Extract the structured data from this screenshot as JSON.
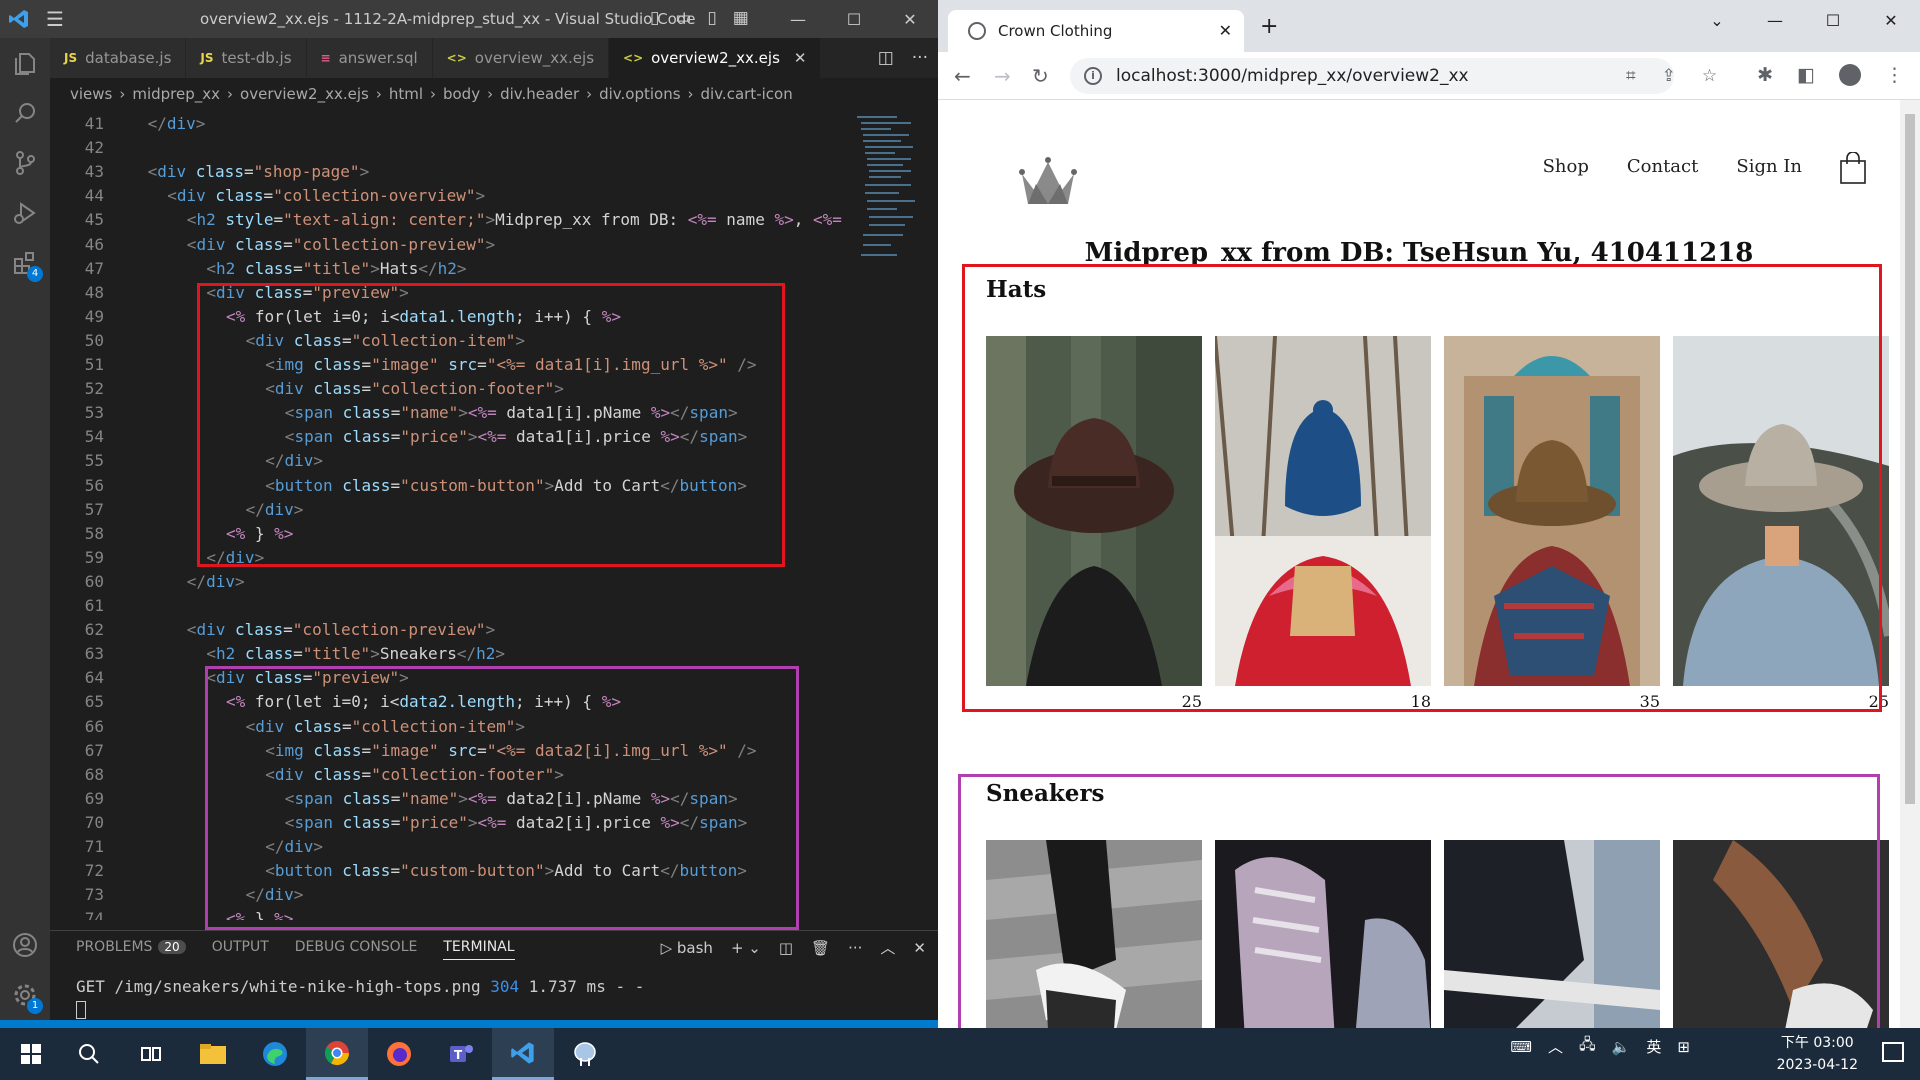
{
  "vscode": {
    "window_title": "overview2_xx.ejs - 1112-2A-midprep_stud_xx - Visual Studio Code",
    "tabs": [
      {
        "label": "database.js",
        "icon": "JS",
        "icon_color": "#e8d44d"
      },
      {
        "label": "test-db.js",
        "icon": "JS",
        "icon_color": "#e8d44d"
      },
      {
        "label": "answer.sql",
        "icon": "≡",
        "icon_color": "#e05d8a"
      },
      {
        "label": "overview_xx.ejs",
        "icon": "<>",
        "icon_color": "#cbcb41"
      },
      {
        "label": "overview2_xx.ejs",
        "icon": "<>",
        "icon_color": "#cbcb41",
        "active": true
      }
    ],
    "breadcrumb": [
      "views",
      "midprep_xx",
      "overview2_xx.ejs",
      "html",
      "body",
      "div.header",
      "div.options",
      "div.cart-icon"
    ],
    "extensions_badge": "4",
    "settings_badge": "1",
    "code_lines": [
      {
        "n": "41",
        "html": "<span class='br'>&lt;/</span><span class='tg'>div</span><span class='br'>&gt;</span>",
        "indent": 1
      },
      {
        "n": "42",
        "html": "",
        "indent": 0
      },
      {
        "n": "43",
        "html": "<span class='br'>&lt;</span><span class='tg'>div</span> <span class='at'>class</span><span class='tx'>=</span><span class='st'>\"shop-page\"</span><span class='br'>&gt;</span>",
        "indent": 1
      },
      {
        "n": "44",
        "html": "<span class='br'>&lt;</span><span class='tg'>div</span> <span class='at'>class</span><span class='tx'>=</span><span class='st'>\"collection-overview\"</span><span class='br'>&gt;</span>",
        "indent": 2
      },
      {
        "n": "45",
        "html": "<span class='br'>&lt;</span><span class='tg'>h2</span> <span class='at'>style</span><span class='tx'>=</span><span class='st'>\"text-align: center;\"</span><span class='br'>&gt;</span><span class='tx'>Midprep_xx from DB: </span><span class='kw'>&lt;%=</span><span class='tx'> name </span><span class='kw'>%&gt;</span><span class='tx'>, </span><span class='kw'>&lt;%=</span>",
        "indent": 3
      },
      {
        "n": "46",
        "html": "<span class='br'>&lt;</span><span class='tg'>div</span> <span class='at'>class</span><span class='tx'>=</span><span class='st'>\"collection-preview\"</span><span class='br'>&gt;</span>",
        "indent": 3
      },
      {
        "n": "47",
        "html": "<span class='br'>&lt;</span><span class='tg'>h2</span> <span class='at'>class</span><span class='tx'>=</span><span class='st'>\"title\"</span><span class='br'>&gt;</span><span class='tx'>Hats</span><span class='br'>&lt;/</span><span class='tg'>h2</span><span class='br'>&gt;</span>",
        "indent": 4
      },
      {
        "n": "48",
        "html": "<span class='br'>&lt;</span><span class='tg'>div</span> <span class='at'>class</span><span class='tx'>=</span><span class='st'>\"preview\"</span><span class='br'>&gt;</span>",
        "indent": 4
      },
      {
        "n": "49",
        "html": "<span class='kw'>&lt;%</span><span class='tx'> for(let i=0; i&lt;</span><span class='at'>data1.length</span><span class='tx'>; i++) { </span><span class='kw'>%&gt;</span>",
        "indent": 5
      },
      {
        "n": "50",
        "html": "<span class='br'>&lt;</span><span class='tg'>div</span> <span class='at'>class</span><span class='tx'>=</span><span class='st'>\"collection-item\"</span><span class='br'>&gt;</span>",
        "indent": 6
      },
      {
        "n": "51",
        "html": "<span class='br'>&lt;</span><span class='tg'>img</span> <span class='at'>class</span><span class='tx'>=</span><span class='st'>\"image\"</span> <span class='at'>src</span><span class='tx'>=</span><span class='st'>\"&lt;%= data1[i].img_url %&gt;\"</span> <span class='br'>/&gt;</span>",
        "indent": 7
      },
      {
        "n": "52",
        "html": "<span class='br'>&lt;</span><span class='tg'>div</span> <span class='at'>class</span><span class='tx'>=</span><span class='st'>\"collection-footer\"</span><span class='br'>&gt;</span>",
        "indent": 7
      },
      {
        "n": "53",
        "html": "<span class='br'>&lt;</span><span class='tg'>span</span> <span class='at'>class</span><span class='tx'>=</span><span class='st'>\"name\"</span><span class='br'>&gt;</span><span class='kw'>&lt;%=</span><span class='tx'> data1[i].pName </span><span class='kw'>%&gt;</span><span class='br'>&lt;/</span><span class='tg'>span</span><span class='br'>&gt;</span>",
        "indent": 8
      },
      {
        "n": "54",
        "html": "<span class='br'>&lt;</span><span class='tg'>span</span> <span class='at'>class</span><span class='tx'>=</span><span class='st'>\"price\"</span><span class='br'>&gt;</span><span class='kw'>&lt;%=</span><span class='tx'> data1[i].price </span><span class='kw'>%&gt;</span><span class='br'>&lt;/</span><span class='tg'>span</span><span class='br'>&gt;</span>",
        "indent": 8
      },
      {
        "n": "55",
        "html": "<span class='br'>&lt;/</span><span class='tg'>div</span><span class='br'>&gt;</span>",
        "indent": 7
      },
      {
        "n": "56",
        "html": "<span class='br'>&lt;</span><span class='tg'>button</span> <span class='at'>class</span><span class='tx'>=</span><span class='st'>\"custom-button\"</span><span class='br'>&gt;</span><span class='tx'>Add to Cart</span><span class='br'>&lt;/</span><span class='tg'>button</span><span class='br'>&gt;</span>",
        "indent": 7
      },
      {
        "n": "57",
        "html": "<span class='br'>&lt;/</span><span class='tg'>div</span><span class='br'>&gt;</span>",
        "indent": 6
      },
      {
        "n": "58",
        "html": "<span class='kw'>&lt;%</span><span class='tx'> } </span><span class='kw'>%&gt;</span>",
        "indent": 5
      },
      {
        "n": "59",
        "html": "<span class='br'>&lt;/</span><span class='tg'>div</span><span class='br'>&gt;</span>",
        "indent": 4
      },
      {
        "n": "60",
        "html": "<span class='br'>&lt;/</span><span class='tg'>div</span><span class='br'>&gt;</span>",
        "indent": 3
      },
      {
        "n": "61",
        "html": "",
        "indent": 0
      },
      {
        "n": "62",
        "html": "<span class='br'>&lt;</span><span class='tg'>div</span> <span class='at'>class</span><span class='tx'>=</span><span class='st'>\"collection-preview\"</span><span class='br'>&gt;</span>",
        "indent": 3
      },
      {
        "n": "63",
        "html": "<span class='br'>&lt;</span><span class='tg'>h2</span> <span class='at'>class</span><span class='tx'>=</span><span class='st'>\"title\"</span><span class='br'>&gt;</span><span class='tx'>Sneakers</span><span class='br'>&lt;/</span><span class='tg'>h2</span><span class='br'>&gt;</span>",
        "indent": 4
      },
      {
        "n": "64",
        "html": "<span class='br'>&lt;</span><span class='tg'>div</span> <span class='at'>class</span><span class='tx'>=</span><span class='st'>\"preview\"</span><span class='br'>&gt;</span>",
        "indent": 4
      },
      {
        "n": "65",
        "html": "<span class='kw'>&lt;%</span><span class='tx'> for(let i=0; i&lt;</span><span class='at'>data2.length</span><span class='tx'>; i++) { </span><span class='kw'>%&gt;</span>",
        "indent": 5
      },
      {
        "n": "66",
        "html": "<span class='br'>&lt;</span><span class='tg'>div</span> <span class='at'>class</span><span class='tx'>=</span><span class='st'>\"collection-item\"</span><span class='br'>&gt;</span>",
        "indent": 6
      },
      {
        "n": "67",
        "html": "<span class='br'>&lt;</span><span class='tg'>img</span> <span class='at'>class</span><span class='tx'>=</span><span class='st'>\"image\"</span> <span class='at'>src</span><span class='tx'>=</span><span class='st'>\"&lt;%= data2[i].img_url %&gt;\"</span> <span class='br'>/&gt;</span>",
        "indent": 7
      },
      {
        "n": "68",
        "html": "<span class='br'>&lt;</span><span class='tg'>div</span> <span class='at'>class</span><span class='tx'>=</span><span class='st'>\"collection-footer\"</span><span class='br'>&gt;</span>",
        "indent": 7
      },
      {
        "n": "69",
        "html": "<span class='br'>&lt;</span><span class='tg'>span</span> <span class='at'>class</span><span class='tx'>=</span><span class='st'>\"name\"</span><span class='br'>&gt;</span><span class='kw'>&lt;%=</span><span class='tx'> data2[i].pName </span><span class='kw'>%&gt;</span><span class='br'>&lt;/</span><span class='tg'>span</span><span class='br'>&gt;</span>",
        "indent": 8
      },
      {
        "n": "70",
        "html": "<span class='br'>&lt;</span><span class='tg'>span</span> <span class='at'>class</span><span class='tx'>=</span><span class='st'>\"price\"</span><span class='br'>&gt;</span><span class='kw'>&lt;%=</span><span class='tx'> data2[i].price </span><span class='kw'>%&gt;</span><span class='br'>&lt;/</span><span class='tg'>span</span><span class='br'>&gt;</span>",
        "indent": 8
      },
      {
        "n": "71",
        "html": "<span class='br'>&lt;/</span><span class='tg'>div</span><span class='br'>&gt;</span>",
        "indent": 7
      },
      {
        "n": "72",
        "html": "<span class='br'>&lt;</span><span class='tg'>button</span> <span class='at'>class</span><span class='tx'>=</span><span class='st'>\"custom-button\"</span><span class='br'>&gt;</span><span class='tx'>Add to Cart</span><span class='br'>&lt;/</span><span class='tg'>button</span><span class='br'>&gt;</span>",
        "indent": 7
      },
      {
        "n": "73",
        "html": "<span class='br'>&lt;/</span><span class='tg'>div</span><span class='br'>&gt;</span>",
        "indent": 6
      },
      {
        "n": "74",
        "html": "<span class='kw'>&lt;%</span><span class='tx'> } </span><span class='kw'>%&gt;</span>",
        "indent": 5
      }
    ],
    "panel": {
      "tabs": [
        "PROBLEMS",
        "OUTPUT",
        "DEBUG CONSOLE",
        "TERMINAL"
      ],
      "problems_count": "20",
      "shell": "bash",
      "terminal_prefix": "GET /img/sneakers/white-nike-high-tops.png ",
      "terminal_status": "304",
      "terminal_suffix": " 1.737 ms - -"
    }
  },
  "chrome": {
    "tab_title": "Crown Clothing",
    "url": "localhost:3000/midprep_xx/overview2_xx"
  },
  "page": {
    "nav": [
      "Shop",
      "Contact",
      "Sign In"
    ],
    "heading": "Midprep_xx from DB: TseHsun Yu, 410411218",
    "sections": [
      {
        "title": "Hats",
        "prices": [
          "25",
          "18",
          "35",
          "25"
        ]
      },
      {
        "title": "Sneakers",
        "prices": []
      }
    ]
  },
  "taskbar": {
    "time": "下午 03:00",
    "date": "2023-04-12",
    "ime": "英"
  }
}
